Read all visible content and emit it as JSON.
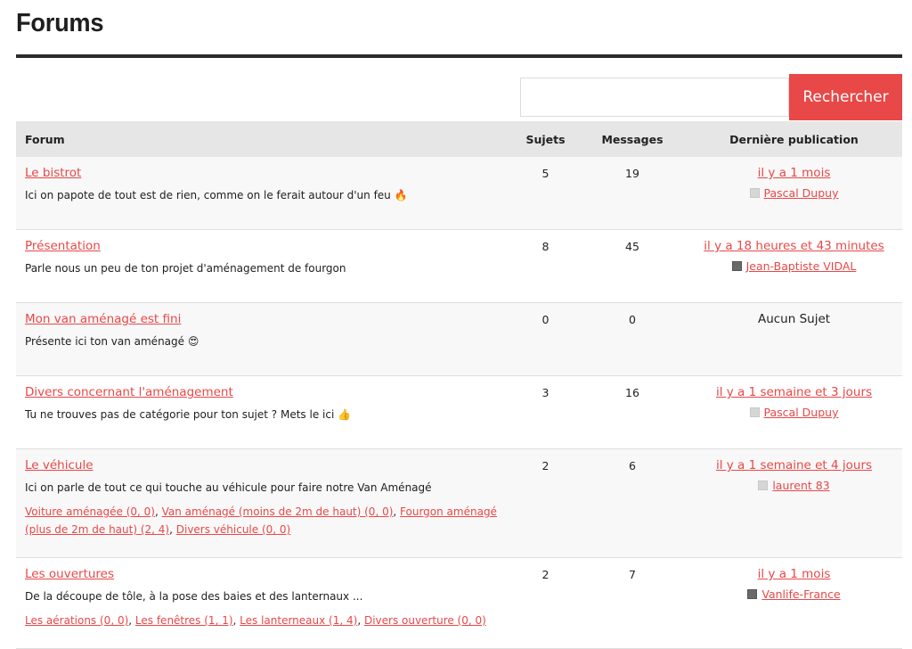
{
  "page": {
    "title": "Forums"
  },
  "search": {
    "placeholder": "",
    "button_label": "Rechercher"
  },
  "table": {
    "headers": {
      "forum": "Forum",
      "topics": "Sujets",
      "posts": "Messages",
      "last": "Dernière publication"
    },
    "rows": [
      {
        "title": "Le bistrot",
        "description": "Ici on papote de tout est de rien, comme on le ferait autour d'un feu",
        "emoji": "🔥",
        "topics": "5",
        "posts": "19",
        "last_time": "il y a 1 mois",
        "last_author": "Pascal Dupuy"
      },
      {
        "title": "Présentation",
        "description": "Parle nous un peu de ton projet d'aménagement de fourgon",
        "topics": "8",
        "posts": "45",
        "last_time": "il y a 18 heures et 43 minutes",
        "last_author": "Jean-Baptiste VIDAL"
      },
      {
        "title": "Mon van aménagé est fini",
        "description": "Présente ici ton van aménagé",
        "emoji": "😍",
        "topics": "0",
        "posts": "0",
        "last_none": "Aucun Sujet"
      },
      {
        "title": "Divers concernant l'aménagement",
        "description": "Tu ne trouves pas de catégorie pour ton sujet ? Mets le ici",
        "emoji": "👍",
        "topics": "3",
        "posts": "16",
        "last_time": "il y a 1 semaine et 3 jours",
        "last_author": "Pascal Dupuy"
      },
      {
        "title": "Le véhicule",
        "description": "Ici on parle de tout ce qui touche au véhicule pour faire notre Van Aménagé",
        "subforums": [
          "Voiture aménagée (0, 0)",
          "Van aménagé (moins de 2m de haut) (0, 0)",
          "Fourgon aménagé (plus de 2m de haut) (2, 4)",
          "Divers véhicule (0, 0)"
        ],
        "topics": "2",
        "posts": "6",
        "last_time": "il y a 1 semaine et 4 jours",
        "last_author": "laurent 83"
      },
      {
        "title": "Les ouvertures",
        "description": "De la découpe de tôle, à la pose des baies et des lanternaux ...",
        "subforums": [
          "Les aérations (0, 0)",
          "Les fenêtres (1, 1)",
          "Les lanterneaux (1, 4)",
          "Divers ouverture (0, 0)"
        ],
        "topics": "2",
        "posts": "7",
        "last_time": "il y a 1 mois",
        "last_author": "Vanlife-France"
      }
    ]
  },
  "colors": {
    "accent": "#e84848",
    "header_bg": "#e6e6e6",
    "rule": "#2b2b2b"
  }
}
